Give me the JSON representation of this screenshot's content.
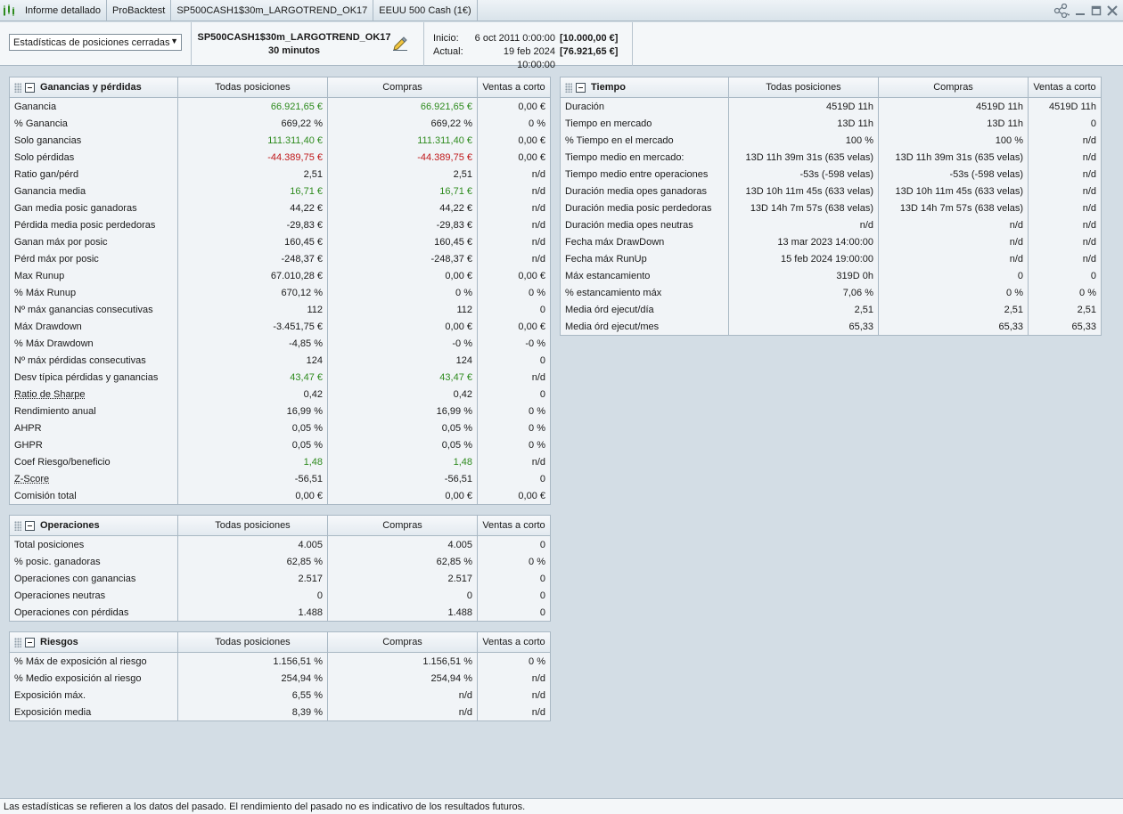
{
  "titlebar": {
    "tabs": [
      "Informe detallado",
      "ProBacktest",
      "SP500CASH1$30m_LARGOTREND_OK17",
      "EEUU 500 Cash (1€)"
    ]
  },
  "header": {
    "select_value": "Estadísticas de posiciones cerradas",
    "system_name": "SP500CASH1$30m_LARGOTREND_OK17",
    "timeframe": "30 minutos",
    "start_label": "Inicio:",
    "start_date": "6 oct 2011 0:00:00",
    "start_capital": "[10.000,00 €]",
    "current_label": "Actual:",
    "current_date": "19 feb 2024 10:00:00",
    "current_capital": "[76.921,65 €]"
  },
  "columns": {
    "all": "Todas posiciones",
    "long": "Compras",
    "short": "Ventas a corto"
  },
  "gains": {
    "title": "Ganancias y pérdidas",
    "rows": [
      {
        "label": "Ganancia",
        "all": "66.921,65 €",
        "long": "66.921,65 €",
        "short": "0,00 €",
        "color": "green"
      },
      {
        "label": "% Ganancia",
        "all": "669,22 %",
        "long": "669,22 %",
        "short": "0 %"
      },
      {
        "label": "Solo ganancias",
        "all": "111.311,40 €",
        "long": "111.311,40 €",
        "short": "0,00 €",
        "color": "green"
      },
      {
        "label": "Solo pérdidas",
        "all": "-44.389,75 €",
        "long": "-44.389,75 €",
        "short": "0,00 €",
        "color": "red"
      },
      {
        "label": "Ratio gan/pérd",
        "all": "2,51",
        "long": "2,51",
        "short": "n/d"
      },
      {
        "label": "Ganancia media",
        "all": "16,71 €",
        "long": "16,71 €",
        "short": "n/d",
        "color": "green"
      },
      {
        "label": "Gan media posic ganadoras",
        "all": "44,22 €",
        "long": "44,22 €",
        "short": "n/d"
      },
      {
        "label": "Pérdida media posic perdedoras",
        "all": "-29,83 €",
        "long": "-29,83 €",
        "short": "n/d"
      },
      {
        "label": "Ganan máx por posic",
        "all": "160,45 €",
        "long": "160,45 €",
        "short": "n/d"
      },
      {
        "label": "Pérd máx por posic",
        "all": "-248,37 €",
        "long": "-248,37 €",
        "short": "n/d"
      },
      {
        "label": "Max Runup",
        "all": "67.010,28 €",
        "long": "0,00 €",
        "short": "0,00 €"
      },
      {
        "label": "% Máx Runup",
        "all": "670,12 %",
        "long": "0 %",
        "short": "0 %"
      },
      {
        "label": "Nº máx ganancias consecutivas",
        "all": "112",
        "long": "112",
        "short": "0"
      },
      {
        "label": "Máx Drawdown",
        "all": "-3.451,75 €",
        "long": "0,00 €",
        "short": "0,00 €"
      },
      {
        "label": "% Máx Drawdown",
        "all": "-4,85 %",
        "long": "-0 %",
        "short": "-0 %"
      },
      {
        "label": "Nº máx pérdidas consecutivas",
        "all": "124",
        "long": "124",
        "short": "0"
      },
      {
        "label": "Desv típica pérdidas y ganancias",
        "all": "43,47 €",
        "long": "43,47 €",
        "short": "n/d",
        "color": "green"
      },
      {
        "label": "Ratio de Sharpe",
        "all": "0,42",
        "long": "0,42",
        "short": "0",
        "underline": true
      },
      {
        "label": "Rendimiento anual",
        "all": "16,99 %",
        "long": "16,99 %",
        "short": "0 %"
      },
      {
        "label": "AHPR",
        "all": "0,05 %",
        "long": "0,05 %",
        "short": "0 %"
      },
      {
        "label": "GHPR",
        "all": "0,05 %",
        "long": "0,05 %",
        "short": "0 %"
      },
      {
        "label": "Coef Riesgo/beneficio",
        "all": "1,48",
        "long": "1,48",
        "short": "n/d",
        "color": "green"
      },
      {
        "label": "Z-Score",
        "all": "-56,51",
        "long": "-56,51",
        "short": "0",
        "underline": true
      },
      {
        "label": "Comisión total",
        "all": "0,00 €",
        "long": "0,00 €",
        "short": "0,00 €"
      }
    ]
  },
  "operations": {
    "title": "Operaciones",
    "rows": [
      {
        "label": "Total posiciones",
        "all": "4.005",
        "long": "4.005",
        "short": "0"
      },
      {
        "label": "% posic. ganadoras",
        "all": "62,85 %",
        "long": "62,85 %",
        "short": "0 %"
      },
      {
        "label": "Operaciones con ganancias",
        "all": "2.517",
        "long": "2.517",
        "short": "0"
      },
      {
        "label": "Operaciones neutras",
        "all": "0",
        "long": "0",
        "short": "0"
      },
      {
        "label": "Operaciones con pérdidas",
        "all": "1.488",
        "long": "1.488",
        "short": "0"
      }
    ]
  },
  "risks": {
    "title": "Riesgos",
    "rows": [
      {
        "label": "% Máx de exposición al riesgo",
        "all": "1.156,51 %",
        "long": "1.156,51 %",
        "short": "0 %"
      },
      {
        "label": "% Medio exposición al riesgo",
        "all": "254,94 %",
        "long": "254,94 %",
        "short": "n/d"
      },
      {
        "label": "Exposición máx.",
        "all": "6,55 %",
        "long": "n/d",
        "short": "n/d"
      },
      {
        "label": "Exposición media",
        "all": "8,39 %",
        "long": "n/d",
        "short": "n/d"
      }
    ]
  },
  "time": {
    "title": "Tiempo",
    "rows": [
      {
        "label": "Duración",
        "all": "4519D 11h",
        "long": "4519D 11h",
        "short": "4519D 11h"
      },
      {
        "label": "Tiempo en mercado",
        "all": "13D 11h",
        "long": "13D 11h",
        "short": "0"
      },
      {
        "label": "% Tiempo en el mercado",
        "all": "100 %",
        "long": "100 %",
        "short": "n/d"
      },
      {
        "label": "Tiempo medio en mercado:",
        "all": "13D 11h 39m 31s (635 velas)",
        "long": "13D 11h 39m 31s (635 velas)",
        "short": "n/d"
      },
      {
        "label": "Tiempo medio entre operaciones",
        "all": "-53s (-598 velas)",
        "long": "-53s (-598 velas)",
        "short": "n/d"
      },
      {
        "label": "Duración media opes ganadoras",
        "all": "13D 10h 11m 45s (633 velas)",
        "long": "13D 10h 11m 45s (633 velas)",
        "short": "n/d"
      },
      {
        "label": "Duración media posic perdedoras",
        "all": "13D 14h 7m 57s (638 velas)",
        "long": "13D 14h 7m 57s (638 velas)",
        "short": "n/d"
      },
      {
        "label": "Duración media opes neutras",
        "all": "n/d",
        "long": "n/d",
        "short": "n/d"
      },
      {
        "label": "Fecha máx DrawDown",
        "all": "13 mar 2023 14:00:00",
        "long": "n/d",
        "short": "n/d"
      },
      {
        "label": "Fecha máx RunUp",
        "all": "15 feb 2024 19:00:00",
        "long": "n/d",
        "short": "n/d"
      },
      {
        "label": "Máx estancamiento",
        "all": "319D 0h",
        "long": "0",
        "short": "0"
      },
      {
        "label": "% estancamiento máx",
        "all": "7,06 %",
        "long": "0 %",
        "short": "0 %"
      },
      {
        "label": "Media órd ejecut/día",
        "all": "2,51",
        "long": "2,51",
        "short": "2,51"
      },
      {
        "label": "Media órd ejecut/mes",
        "all": "65,33",
        "long": "65,33",
        "short": "65,33"
      }
    ]
  },
  "footer": {
    "disclaimer": "Las estadísticas se refieren a los datos del pasado. El rendimiento del pasado no es indicativo de los resultados futuros."
  },
  "colors": {
    "positive": "#2e8b1e",
    "negative": "#c0181a"
  },
  "icons": [
    "app-chart-icon",
    "share-icon",
    "minimize-icon",
    "maximize-icon",
    "close-icon",
    "edit-pencil-icon",
    "collapse-icon",
    "drag-grip-icon"
  ]
}
